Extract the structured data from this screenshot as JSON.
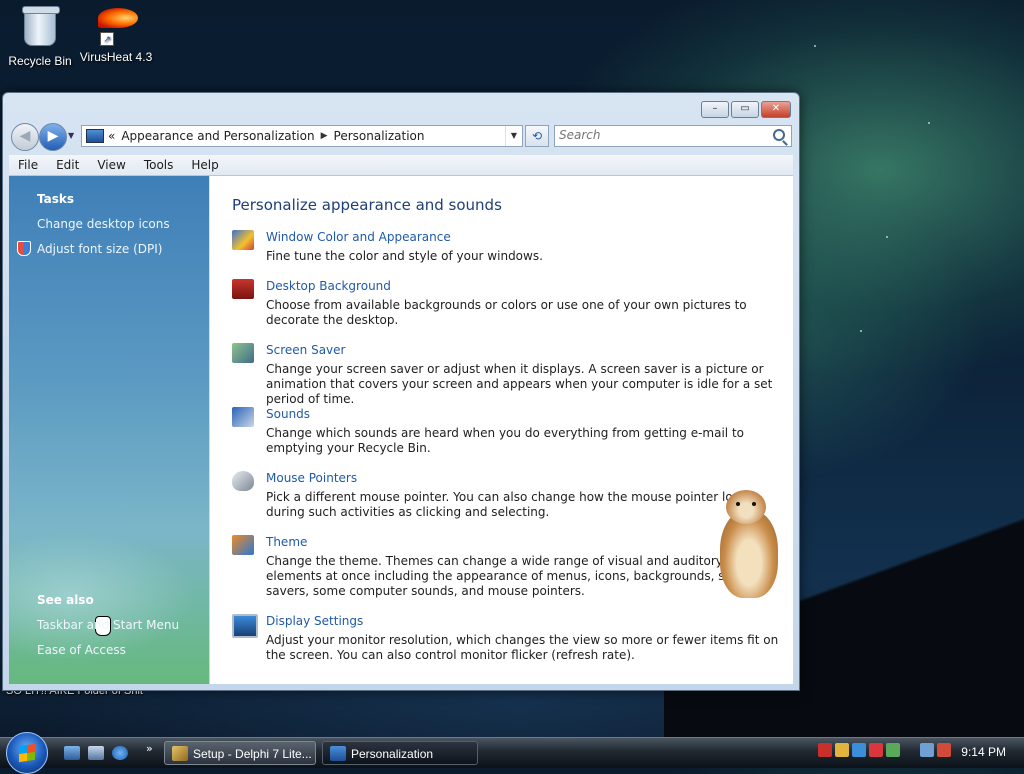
{
  "desktop": {
    "icons": [
      {
        "label": "Recycle Bin",
        "icon": "recycle-bin-icon"
      },
      {
        "label": "VirusHeat 4.3",
        "icon": "virusheat-flame-icon"
      }
    ],
    "partial_label": "SO LIT!! AIKE   Folder of Shit"
  },
  "window": {
    "address": {
      "overflow": "«",
      "crumbs": [
        "Appearance and Personalization",
        "Personalization"
      ]
    },
    "search": {
      "placeholder": "Search"
    },
    "menu": [
      "File",
      "Edit",
      "View",
      "Tools",
      "Help"
    ],
    "sidebar": {
      "tasks_heading": "Tasks",
      "tasks": [
        "Change desktop icons",
        "Adjust font size (DPI)"
      ],
      "see_also_heading": "See also",
      "see_also": [
        "Taskbar and Start Menu",
        "Ease of Access"
      ]
    },
    "content": {
      "heading": "Personalize appearance and sounds",
      "items": [
        {
          "title": "Window Color and Appearance",
          "desc": "Fine tune the color and style of your windows.",
          "icon": "window-color-icon"
        },
        {
          "title": "Desktop Background",
          "desc": "Choose from available backgrounds or colors or use one of your own pictures to decorate the desktop.",
          "icon": "desktop-background-icon"
        },
        {
          "title": "Screen Saver",
          "desc": "Change your screen saver or adjust when it displays. A screen saver is a picture or animation that covers your screen and appears when your computer is idle for a set period of time.",
          "icon": "screen-saver-icon"
        },
        {
          "title": "Sounds",
          "desc": "Change which sounds are heard when you do everything from getting e-mail to emptying your Recycle Bin.",
          "icon": "sounds-icon"
        },
        {
          "title": "Mouse Pointers",
          "desc": "Pick a different mouse pointer. You can also change how the mouse pointer looks during such activities as clicking and selecting.",
          "icon": "mouse-pointers-icon"
        },
        {
          "title": "Theme",
          "desc": "Change the theme. Themes can change a wide range of visual and auditory elements at once including the appearance of menus, icons, backgrounds, screen savers, some computer sounds, and mouse pointers.",
          "icon": "theme-icon"
        },
        {
          "title": "Display Settings",
          "desc": "Adjust your monitor resolution, which changes the view so more or fewer items fit on the screen. You can also control monitor flicker (refresh rate).",
          "icon": "display-settings-icon"
        }
      ]
    }
  },
  "taskbar": {
    "quicklaunch_chevron": "»",
    "tasks": [
      {
        "label": "Setup - Delphi 7 Lite...",
        "icon": "setup-icon"
      },
      {
        "label": "Personalization",
        "icon": "personalization-icon"
      }
    ],
    "clock": "9:14 PM"
  },
  "colors": {
    "link": "#1f5aa8",
    "heading": "#1e3f78",
    "sidebar_top": "#3f7fb8"
  }
}
